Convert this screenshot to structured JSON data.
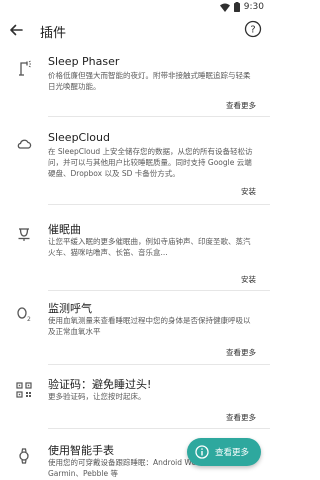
{
  "status_bar": {
    "time": "9:30"
  },
  "app_bar": {
    "title": "插件"
  },
  "plugins": [
    {
      "title": "Sleep Phaser",
      "description": "价格低廉但强大而智能的夜灯。附带非接触式睡眠追踪与轻柔日光唤醒功能。",
      "action": "查看更多",
      "icon": "lamp-icon"
    },
    {
      "title": "SleepCloud",
      "description": "在 SleepCloud 上安全储存您的数据，从您的所有设备轻松访问，并可以与其他用户比较睡眠质量。同时支持 Google 云端硬盘、Dropbox 以及 SD 卡备份方式。",
      "action": "安装",
      "icon": "cloud-icon"
    },
    {
      "title": "催眠曲",
      "description": "让您平缓入眠的更多催眠曲，例如寺庙钟声、印度圣歌、蒸汽火车、猫咪咕噜声、长笛、音乐盒...",
      "action": "安装",
      "icon": "bell-icon"
    },
    {
      "title": "监测呼气",
      "description": "使用血氧测量来查看睡眠过程中您的身体是否保持健康呼吸以及正常血氧水平",
      "action": "查看更多",
      "icon": "o2-icon"
    },
    {
      "title": "验证码：避免睡过头!",
      "description": "更多验证码，让您按时起床。",
      "action": "查看更多",
      "icon": "qr-code-icon"
    },
    {
      "title": "使用智能手表",
      "description": "使用您的可穿戴设备跟踪睡眠：Android Wear、Gear、Garmin、Pebble 等",
      "action": "",
      "icon": "watch-icon"
    }
  ],
  "fab": {
    "label": "查看更多",
    "icon": "info-icon"
  },
  "colors": {
    "accent": "#2ea89e"
  }
}
